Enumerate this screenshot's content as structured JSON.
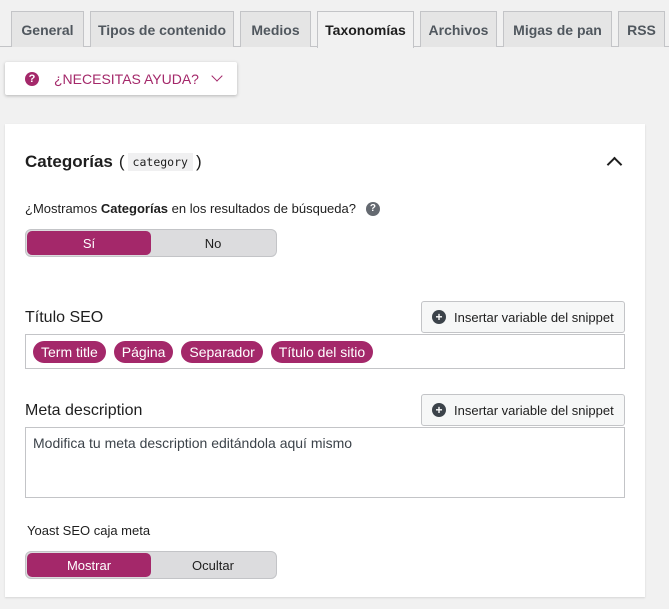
{
  "tabs": [
    {
      "label": "General",
      "active": false
    },
    {
      "label": "Tipos de contenido",
      "active": false
    },
    {
      "label": "Medios",
      "active": false
    },
    {
      "label": "Taxonomías",
      "active": true
    },
    {
      "label": "Archivos",
      "active": false
    },
    {
      "label": "Migas de pan",
      "active": false
    },
    {
      "label": "RSS",
      "active": false
    }
  ],
  "help": {
    "icon": "question-icon",
    "label": "¿NECESITAS AYUDA?"
  },
  "panel": {
    "title": "Categorías",
    "slug": "category",
    "question_prefix": "¿Mostramos ",
    "question_bold": "Categorías",
    "question_suffix": " en los resultados de búsqueda?",
    "search_toggle": {
      "on": "Sí",
      "off": "No"
    },
    "seo_title_label": "Título SEO",
    "insert_button": "Insertar variable del snippet",
    "seo_chips": [
      "Term title",
      "Página",
      "Separador",
      "Título del sitio"
    ],
    "meta_label": "Meta description",
    "meta_placeholder": "Modifica tu meta description editándola aquí mismo",
    "metabox_label": "Yoast SEO caja meta",
    "metabox_toggle": {
      "on": "Mostrar",
      "off": "Ocultar"
    }
  },
  "colors": {
    "accent": "#a4286a"
  }
}
